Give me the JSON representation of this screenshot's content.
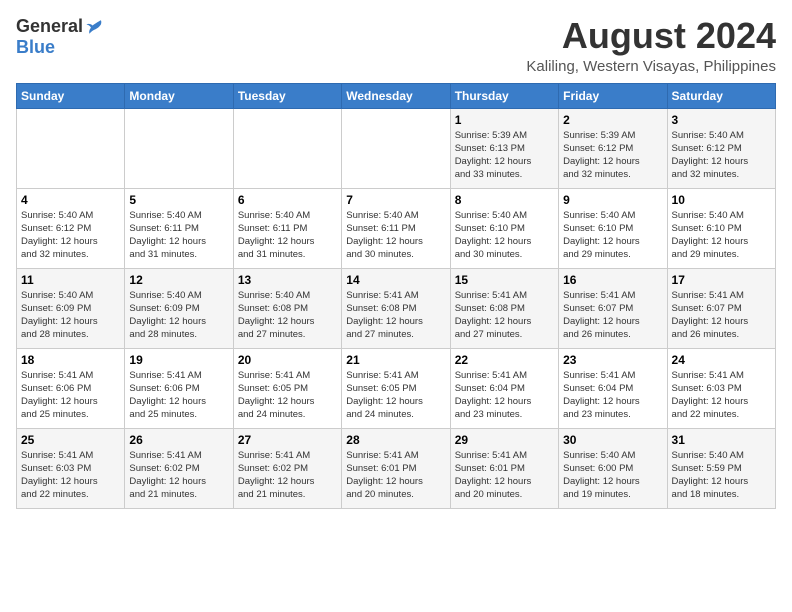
{
  "logo": {
    "general": "General",
    "blue": "Blue"
  },
  "title": "August 2024",
  "subtitle": "Kaliling, Western Visayas, Philippines",
  "days_of_week": [
    "Sunday",
    "Monday",
    "Tuesday",
    "Wednesday",
    "Thursday",
    "Friday",
    "Saturday"
  ],
  "weeks": [
    [
      {
        "day": "",
        "info": ""
      },
      {
        "day": "",
        "info": ""
      },
      {
        "day": "",
        "info": ""
      },
      {
        "day": "",
        "info": ""
      },
      {
        "day": "1",
        "info": "Sunrise: 5:39 AM\nSunset: 6:13 PM\nDaylight: 12 hours\nand 33 minutes."
      },
      {
        "day": "2",
        "info": "Sunrise: 5:39 AM\nSunset: 6:12 PM\nDaylight: 12 hours\nand 32 minutes."
      },
      {
        "day": "3",
        "info": "Sunrise: 5:40 AM\nSunset: 6:12 PM\nDaylight: 12 hours\nand 32 minutes."
      }
    ],
    [
      {
        "day": "4",
        "info": "Sunrise: 5:40 AM\nSunset: 6:12 PM\nDaylight: 12 hours\nand 32 minutes."
      },
      {
        "day": "5",
        "info": "Sunrise: 5:40 AM\nSunset: 6:11 PM\nDaylight: 12 hours\nand 31 minutes."
      },
      {
        "day": "6",
        "info": "Sunrise: 5:40 AM\nSunset: 6:11 PM\nDaylight: 12 hours\nand 31 minutes."
      },
      {
        "day": "7",
        "info": "Sunrise: 5:40 AM\nSunset: 6:11 PM\nDaylight: 12 hours\nand 30 minutes."
      },
      {
        "day": "8",
        "info": "Sunrise: 5:40 AM\nSunset: 6:10 PM\nDaylight: 12 hours\nand 30 minutes."
      },
      {
        "day": "9",
        "info": "Sunrise: 5:40 AM\nSunset: 6:10 PM\nDaylight: 12 hours\nand 29 minutes."
      },
      {
        "day": "10",
        "info": "Sunrise: 5:40 AM\nSunset: 6:10 PM\nDaylight: 12 hours\nand 29 minutes."
      }
    ],
    [
      {
        "day": "11",
        "info": "Sunrise: 5:40 AM\nSunset: 6:09 PM\nDaylight: 12 hours\nand 28 minutes."
      },
      {
        "day": "12",
        "info": "Sunrise: 5:40 AM\nSunset: 6:09 PM\nDaylight: 12 hours\nand 28 minutes."
      },
      {
        "day": "13",
        "info": "Sunrise: 5:40 AM\nSunset: 6:08 PM\nDaylight: 12 hours\nand 27 minutes."
      },
      {
        "day": "14",
        "info": "Sunrise: 5:41 AM\nSunset: 6:08 PM\nDaylight: 12 hours\nand 27 minutes."
      },
      {
        "day": "15",
        "info": "Sunrise: 5:41 AM\nSunset: 6:08 PM\nDaylight: 12 hours\nand 27 minutes."
      },
      {
        "day": "16",
        "info": "Sunrise: 5:41 AM\nSunset: 6:07 PM\nDaylight: 12 hours\nand 26 minutes."
      },
      {
        "day": "17",
        "info": "Sunrise: 5:41 AM\nSunset: 6:07 PM\nDaylight: 12 hours\nand 26 minutes."
      }
    ],
    [
      {
        "day": "18",
        "info": "Sunrise: 5:41 AM\nSunset: 6:06 PM\nDaylight: 12 hours\nand 25 minutes."
      },
      {
        "day": "19",
        "info": "Sunrise: 5:41 AM\nSunset: 6:06 PM\nDaylight: 12 hours\nand 25 minutes."
      },
      {
        "day": "20",
        "info": "Sunrise: 5:41 AM\nSunset: 6:05 PM\nDaylight: 12 hours\nand 24 minutes."
      },
      {
        "day": "21",
        "info": "Sunrise: 5:41 AM\nSunset: 6:05 PM\nDaylight: 12 hours\nand 24 minutes."
      },
      {
        "day": "22",
        "info": "Sunrise: 5:41 AM\nSunset: 6:04 PM\nDaylight: 12 hours\nand 23 minutes."
      },
      {
        "day": "23",
        "info": "Sunrise: 5:41 AM\nSunset: 6:04 PM\nDaylight: 12 hours\nand 23 minutes."
      },
      {
        "day": "24",
        "info": "Sunrise: 5:41 AM\nSunset: 6:03 PM\nDaylight: 12 hours\nand 22 minutes."
      }
    ],
    [
      {
        "day": "25",
        "info": "Sunrise: 5:41 AM\nSunset: 6:03 PM\nDaylight: 12 hours\nand 22 minutes."
      },
      {
        "day": "26",
        "info": "Sunrise: 5:41 AM\nSunset: 6:02 PM\nDaylight: 12 hours\nand 21 minutes."
      },
      {
        "day": "27",
        "info": "Sunrise: 5:41 AM\nSunset: 6:02 PM\nDaylight: 12 hours\nand 21 minutes."
      },
      {
        "day": "28",
        "info": "Sunrise: 5:41 AM\nSunset: 6:01 PM\nDaylight: 12 hours\nand 20 minutes."
      },
      {
        "day": "29",
        "info": "Sunrise: 5:41 AM\nSunset: 6:01 PM\nDaylight: 12 hours\nand 20 minutes."
      },
      {
        "day": "30",
        "info": "Sunrise: 5:40 AM\nSunset: 6:00 PM\nDaylight: 12 hours\nand 19 minutes."
      },
      {
        "day": "31",
        "info": "Sunrise: 5:40 AM\nSunset: 5:59 PM\nDaylight: 12 hours\nand 18 minutes."
      }
    ]
  ]
}
